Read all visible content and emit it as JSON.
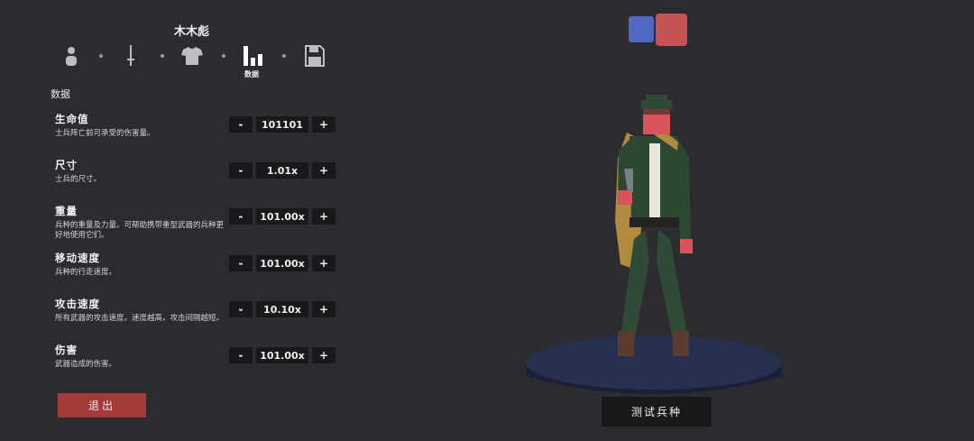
{
  "unit": {
    "name": "木木彪"
  },
  "tabs": {
    "items": [
      {
        "icon": "person-icon"
      },
      {
        "icon": "sword-icon"
      },
      {
        "icon": "shirt-icon"
      },
      {
        "icon": "bar-chart-icon",
        "label": "数据"
      },
      {
        "icon": "save-icon"
      }
    ],
    "active_label": "数据"
  },
  "section": {
    "title": "数据"
  },
  "stats": [
    {
      "name": "生命值",
      "desc": "士兵阵亡前可承受的伤害量。",
      "value": "101101"
    },
    {
      "name": "尺寸",
      "desc": "士兵的尺寸。",
      "value": "1.01x"
    },
    {
      "name": "重量",
      "desc": "兵种的重量及力量。可帮助携带重型武器的兵种更好地使用它们。",
      "value": "101.00x"
    },
    {
      "name": "移动速度",
      "desc": "兵种的行走速度。",
      "value": "101.00x"
    },
    {
      "name": "攻击速度",
      "desc": "所有武器的攻击速度。速度越高，攻击间隔越短。",
      "value": "10.10x"
    },
    {
      "name": "伤害",
      "desc": "武器造成的伤害。",
      "value": "101.00x"
    }
  ],
  "controls": {
    "minus": "-",
    "plus": "+"
  },
  "exit_button": "退出",
  "test_button": "测试兵种",
  "team_colors": {
    "blue": "#5167c2",
    "red": "#c65353"
  }
}
